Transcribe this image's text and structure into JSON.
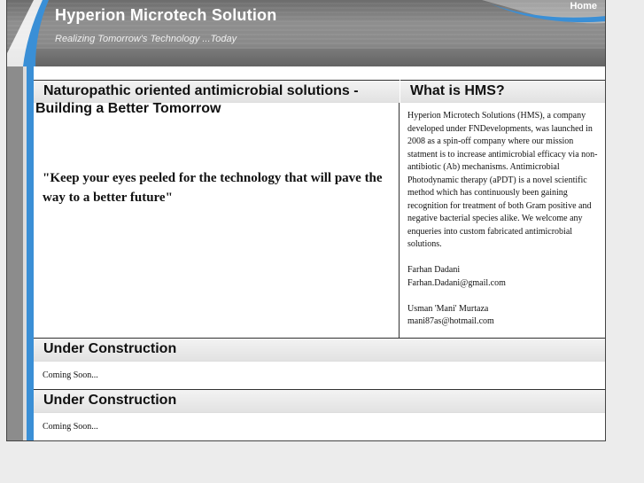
{
  "header": {
    "title": "Hyperion Microtech Solution",
    "tagline": "Realizing Tomorrow's Technology ...Today",
    "nav_home": "Home"
  },
  "main": {
    "heading_line1": "Naturopathic oriented antimicrobial solutions -",
    "heading_line2": "Building a Better Tomorrow",
    "quote": "\"Keep your eyes peeled for the technology that will pave the way to a better future\""
  },
  "sidebar": {
    "heading": "What is HMS?",
    "description": "Hyperion Microtech Solutions (HMS), a company developed under FNDevelopments, was launched in 2008 as a spin-off company where our mission statment is to increase antimicrobial efficacy via non-antibiotic (Ab) mechanisms. Antimicrobial Photodynamic therapy (aPDT) is a novel scientific method which has continuously been gaining recognition for treatment of both Gram positive and negative bacterial species alike. We welcome any enqueries into custom fabricated antimicrobial solutions.",
    "contact1_name": "Farhan Dadani",
    "contact1_email": "Farhan.Dadani@gmail.com",
    "contact2_name": "Usman 'Mani' Murtaza",
    "contact2_email": "mani87as@hotmail.com"
  },
  "sections": [
    {
      "heading": "Under Construction",
      "body": "Coming Soon..."
    },
    {
      "heading": "Under Construction",
      "body": "Coming Soon..."
    }
  ],
  "colors": {
    "header_gray": "#8e8e8e",
    "accent_blue": "#3a8fd6",
    "page_bg": "#ececec"
  }
}
